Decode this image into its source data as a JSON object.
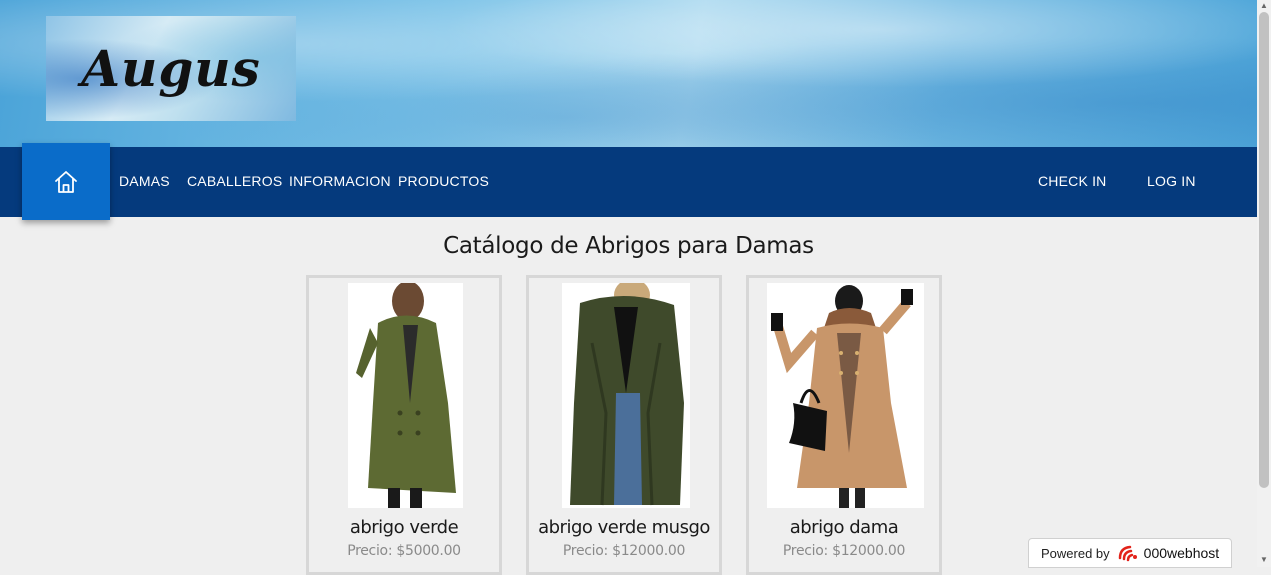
{
  "header": {
    "logo_text": "Augus"
  },
  "nav": {
    "home_icon": "home-icon",
    "links": [
      "DAMAS",
      "CABALLEROS",
      "INFORMACION",
      "PRODUCTOS"
    ],
    "check_in": "CHECK IN",
    "log_in": "LOG IN"
  },
  "catalog": {
    "title": "Catálogo de Abrigos para Damas",
    "products": [
      {
        "name": "abrigo verde",
        "price": "Precio: $5000.00"
      },
      {
        "name": "abrigo verde musgo",
        "price": "Precio: $12000.00"
      },
      {
        "name": "abrigo dama",
        "price": "Precio: $12000.00"
      }
    ]
  },
  "badge": {
    "powered_by": "Powered by",
    "brand": "000webhost"
  },
  "colors": {
    "navbar": "#053a7d",
    "home_button": "#0a6cc9",
    "page_bg": "#efefef"
  }
}
